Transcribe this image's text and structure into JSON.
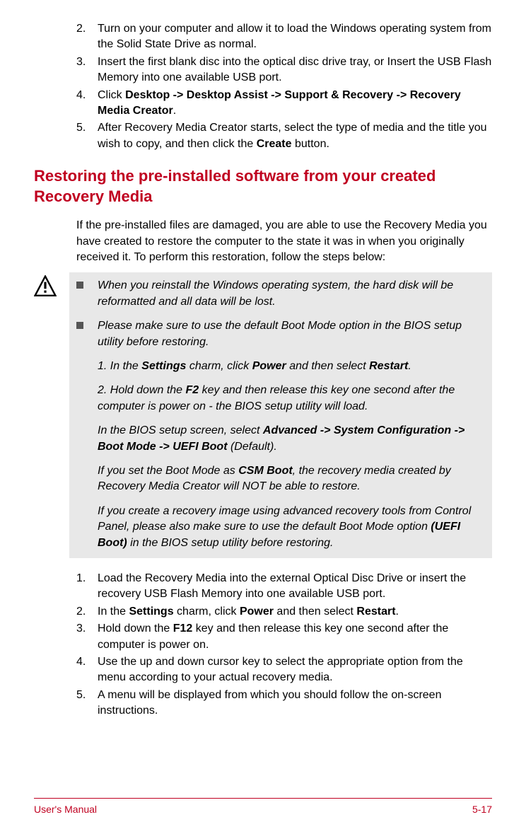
{
  "list1": {
    "items": [
      {
        "num": "2.",
        "text": "Turn on your computer and allow it to load the Windows operating system from the Solid State Drive as normal."
      },
      {
        "num": "3.",
        "text": "Insert the first blank disc into the optical disc drive tray, or Insert the USB Flash Memory into one available USB port."
      },
      {
        "num": "4.",
        "prefix": "Click ",
        "bold": "Desktop -> Desktop Assist -> Support & Recovery -> Recovery Media Creator",
        "suffix": "."
      },
      {
        "num": "5.",
        "prefix": "After Recovery Media Creator starts, select the type of media and the title you wish to copy, and then click the ",
        "bold": "Create",
        "suffix": " button."
      }
    ]
  },
  "heading": "Restoring the pre-installed software from your created Recovery Media",
  "intro": "If the pre-installed files are damaged, you are able to use the Recovery Media you have created to restore the computer to the state it was in when you originally received it. To perform this restoration, follow the steps below:",
  "caution": {
    "b1": "When you reinstall the Windows operating system, the hard disk will be reformatted and all data will be lost.",
    "b2": "Please make sure to use the default Boot Mode option in the BIOS setup utility before restoring.",
    "p1_a": "1. In the ",
    "p1_b": "Settings",
    "p1_c": " charm, click ",
    "p1_d": "Power",
    "p1_e": " and then select ",
    "p1_f": "Restart",
    "p1_g": ".",
    "p2_a": "2. Hold down the ",
    "p2_b": "F2",
    "p2_c": " key and then release this key one second after the computer is power on - the BIOS setup utility will load.",
    "p3_a": "In the BIOS setup screen, select ",
    "p3_b": "Advanced -> System Configuration -> Boot Mode -> UEFI Boot",
    "p3_c": " (Default).",
    "p4_a": "If you set the Boot Mode as ",
    "p4_b": "CSM Boot",
    "p4_c": ", the recovery media created by Recovery Media Creator will NOT be able to restore.",
    "p5_a": "If you create a recovery image using advanced recovery tools from Control Panel, please also make sure to use the default Boot Mode option ",
    "p5_b": "(UEFI Boot)",
    "p5_c": " in the BIOS setup utility before restoring."
  },
  "list2": {
    "i1": {
      "num": "1.",
      "text": "Load the Recovery Media into the external Optical Disc Drive or insert the recovery USB Flash Memory into one available USB port."
    },
    "i2": {
      "num": "2.",
      "a": "In the ",
      "b": "Settings",
      "c": " charm, click ",
      "d": "Power",
      "e": " and then select ",
      "f": "Restart",
      "g": "."
    },
    "i3": {
      "num": "3.",
      "a": "Hold down the ",
      "b": "F12",
      "c": " key and then release this key one second after the computer is power on."
    },
    "i4": {
      "num": "4.",
      "text": "Use the up and down cursor key to select the appropriate option from the menu according to your actual recovery media."
    },
    "i5": {
      "num": "5.",
      "text": "A menu will be displayed from which you should follow the on-screen instructions."
    }
  },
  "footer": {
    "left": "User's Manual",
    "right": "5-17"
  }
}
